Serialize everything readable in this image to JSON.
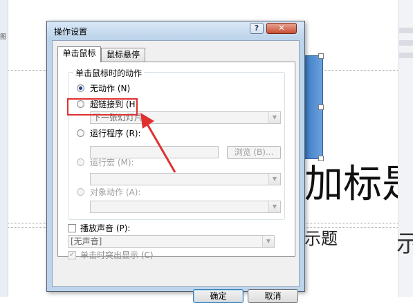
{
  "background": {
    "title_text": "加标是",
    "subtitle_text": "示题",
    "edge_char": "示",
    "edge_tiny": "图"
  },
  "dialog": {
    "title": "操作设置",
    "help": "?",
    "close": "✕",
    "tabs": [
      {
        "label": "单击鼠标",
        "active": true
      },
      {
        "label": "鼠标悬停",
        "active": false
      }
    ],
    "group_title": "单击鼠标时的动作",
    "options": {
      "none": "无动作 (N)",
      "hyperlink": "超链接到 (H)",
      "hyperlink_target": "下一张幻灯片",
      "run_program": "运行程序 (R):",
      "browse": "浏览 (B)...",
      "run_macro": "运行宏 (M):",
      "object_action": "对象动作 (A):"
    },
    "play_sound": {
      "label": "播放声音 (P):",
      "value": "[无声音]"
    },
    "highlight_click": "单击时突出显示 (C)",
    "ok": "确定",
    "cancel": "取消"
  },
  "colors": {
    "annotation": "#e03030",
    "dialog_frame": "#bcd4ec",
    "accent_blue": "#3f7ec6"
  }
}
